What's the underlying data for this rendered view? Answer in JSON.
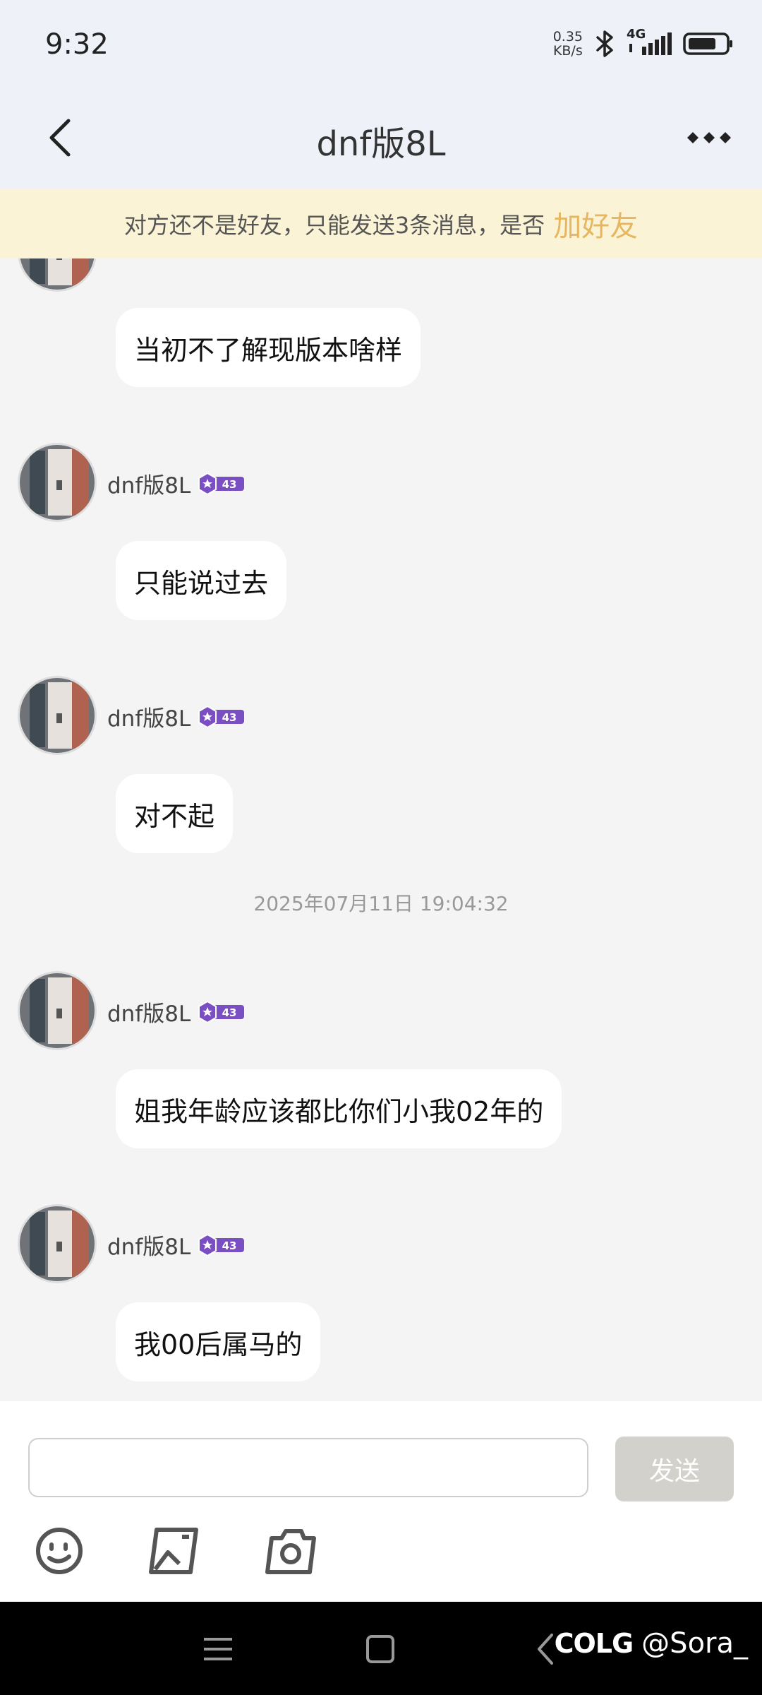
{
  "status_bar": {
    "time": "9:32",
    "net_speed_value": "0.35",
    "net_speed_unit": "KB/s",
    "network": "4G",
    "icons": [
      "bluetooth-icon",
      "signal-icon",
      "battery-icon"
    ]
  },
  "header": {
    "title": "dnf版8L",
    "back_icon": "back-arrow-icon",
    "more_icon": "more-dots-icon"
  },
  "notice": {
    "text": "对方还不是好友，只能发送3条消息，是否",
    "action": "加好友"
  },
  "chat": {
    "sender_name": "dnf版8L",
    "level": "43",
    "messages": [
      {
        "text": "当初不了解现版本啥样"
      },
      {
        "text": "只能说过去"
      },
      {
        "text": "对不起"
      },
      {
        "text": "姐我年龄应该都比你们小我02年的"
      },
      {
        "text": "我00后属马的"
      }
    ],
    "timestamp": "2025年07月11日 19:04:32"
  },
  "input": {
    "value": "",
    "placeholder": "",
    "send_label": "发送",
    "tools": [
      "emoji-icon",
      "image-icon",
      "camera-icon"
    ]
  },
  "nav": {
    "icons": [
      "menu-icon",
      "home-icon",
      "back-icon"
    ]
  },
  "watermark": {
    "logo": "COLG",
    "user": "@Sora_"
  },
  "colors": {
    "accent": "#e6b660",
    "notice_bg": "#fbf3d6",
    "header_bg": "#eef2f8",
    "chat_bg": "#f4f4f4",
    "badge": "#7b4fc4",
    "send_button": "#d3d1cc"
  }
}
